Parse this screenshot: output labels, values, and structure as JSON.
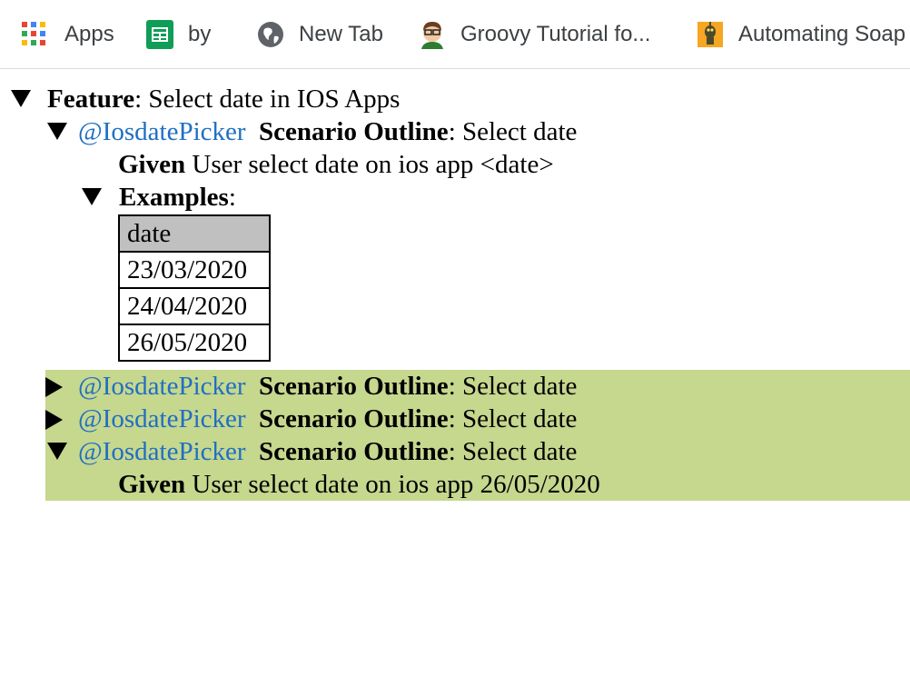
{
  "bookmarks": [
    {
      "label": "Apps",
      "icon": "apps-grid-icon"
    },
    {
      "label": "by",
      "icon": "sheets-icon"
    },
    {
      "label": "New Tab",
      "icon": "globe-icon"
    },
    {
      "label": "Groovy Tutorial fo...",
      "icon": "avatar-icon"
    },
    {
      "label": "Automating Soap",
      "icon": "robot-icon"
    }
  ],
  "colors": {
    "tag": "#1f6fc3",
    "passed_highlight": "#c6d78e",
    "table_header": "#c0c0c0"
  },
  "feature": {
    "keyword": "Feature",
    "name": ": Select date in IOS Apps",
    "toggle": "expanded"
  },
  "outline": {
    "tag": "@IosdatePicker",
    "keyword": "Scenario Outline",
    "name": ": Select date",
    "toggle": "expanded",
    "step_keyword": "Given",
    "step_text": " User select date on ios app <date>",
    "examples_keyword": "Examples",
    "examples_suffix": ":",
    "examples_toggle": "expanded",
    "table_header": "date",
    "table_rows": [
      "23/03/2020",
      "24/04/2020",
      "26/05/2020"
    ]
  },
  "scenarios": [
    {
      "tag": "@IosdatePicker",
      "keyword": "Scenario Outline",
      "name": ": Select date",
      "toggle": "collapsed"
    },
    {
      "tag": "@IosdatePicker",
      "keyword": "Scenario Outline",
      "name": ": Select date",
      "toggle": "collapsed"
    },
    {
      "tag": "@IosdatePicker",
      "keyword": "Scenario Outline",
      "name": ": Select date",
      "toggle": "expanded",
      "step_keyword": "Given",
      "step_text": " User select date on ios app 26/05/2020"
    }
  ]
}
